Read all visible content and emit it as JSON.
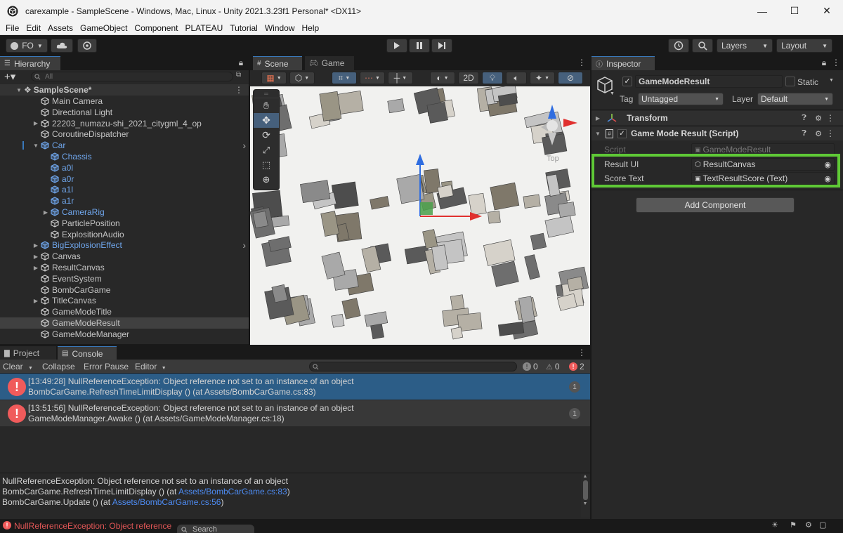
{
  "window": {
    "title": "carexample - SampleScene - Windows, Mac, Linux - Unity 2021.3.23f1 Personal* <DX11>",
    "minimize": "—",
    "maximize": "☐",
    "close": "✕"
  },
  "menu": [
    "File",
    "Edit",
    "Assets",
    "GameObject",
    "Component",
    "PLATEAU",
    "Tutorial",
    "Window",
    "Help"
  ],
  "toolbar": {
    "account": "FO",
    "layers": "Layers",
    "layout": "Layout"
  },
  "hierarchy": {
    "tab": "Hierarchy",
    "search_placeholder": "All",
    "scene": "SampleScene*",
    "items": [
      {
        "label": "Main Camera"
      },
      {
        "label": "Directional Light"
      },
      {
        "label": "22203_numazu-shi_2021_citygml_4_op"
      },
      {
        "label": "CoroutineDispatcher"
      },
      {
        "label": "Car"
      },
      {
        "label": "Chassis"
      },
      {
        "label": "a0l"
      },
      {
        "label": "a0r"
      },
      {
        "label": "a1l"
      },
      {
        "label": "a1r"
      },
      {
        "label": "CameraRig"
      },
      {
        "label": "ParticlePosition"
      },
      {
        "label": "ExplositionAudio"
      },
      {
        "label": "BigExplosionEffect"
      },
      {
        "label": "Canvas"
      },
      {
        "label": "ResultCanvas"
      },
      {
        "label": "EventSystem"
      },
      {
        "label": "BombCarGame"
      },
      {
        "label": "TitleCanvas"
      },
      {
        "label": "GameModeTitle"
      },
      {
        "label": "GameModeResult"
      },
      {
        "label": "GameModeManager"
      }
    ]
  },
  "scene": {
    "tab_scene": "Scene",
    "tab_game": "Game",
    "mode_2d": "2D",
    "gizmo_label": "Top"
  },
  "inspector": {
    "tab": "Inspector",
    "object_name": "GameModeResult",
    "static_label": "Static",
    "tag_label": "Tag",
    "tag_value": "Untagged",
    "layer_label": "Layer",
    "layer_value": "Default",
    "transform_label": "Transform",
    "component_label": "Game Mode Result (Script)",
    "script_label": "Script",
    "script_value": "GameModeResult",
    "result_ui_label": "Result UI",
    "result_ui_value": "ResultCanvas",
    "score_text_label": "Score Text",
    "score_text_value": "TextResultScore (Text)",
    "add_component": "Add Component"
  },
  "console": {
    "tab_project": "Project",
    "tab_console": "Console",
    "clear": "Clear",
    "collapse": "Collapse",
    "error_pause": "Error Pause",
    "editor": "Editor",
    "count_info": "0",
    "count_warn": "0",
    "count_error": "2",
    "entries": [
      {
        "line1": "[13:49:28] NullReferenceException: Object reference not set to an instance of an object",
        "line2": "BombCarGame.RefreshTimeLimitDisplay () (at Assets/BombCarGame.cs:83)",
        "count": "1"
      },
      {
        "line1": "[13:51:56] NullReferenceException: Object reference not set to an instance of an object",
        "line2": "GameModeManager.Awake () (at Assets/GameModeManager.cs:18)",
        "count": "1"
      }
    ],
    "detail_line1": "NullReferenceException: Object reference not set to an instance of an object",
    "detail_line2_prefix": "BombCarGame.RefreshTimeLimitDisplay () (at ",
    "detail_line2_link": "Assets/BombCarGame.cs:83",
    "detail_line2_suffix": ")",
    "detail_line3_prefix": "BombCarGame.Update () (at ",
    "detail_line3_link": "Assets/BombCarGame.cs:56",
    "detail_line3_suffix": ")"
  },
  "statusbar": {
    "message": "NullReferenceException: Object reference",
    "search": "Search"
  },
  "colors": {
    "accent_blue": "#3a79bb",
    "highlight_green": "#5fc936",
    "error_red": "#f05b5b",
    "prefab_blue": "#6fa6ec"
  }
}
